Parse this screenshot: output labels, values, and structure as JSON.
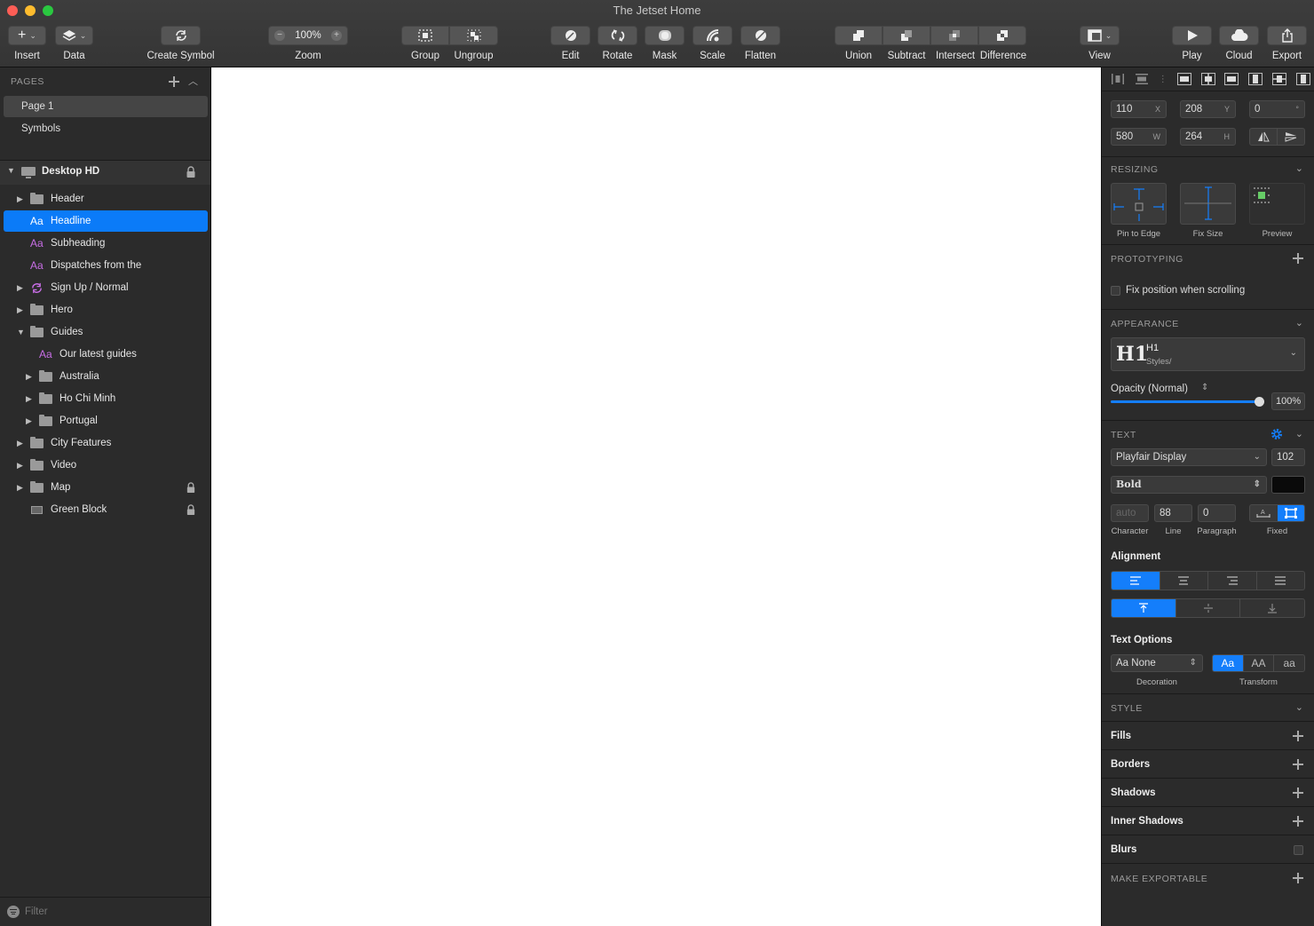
{
  "window": {
    "title": "The Jetset Home"
  },
  "toolbar": {
    "insert": "Insert",
    "data": "Data",
    "create_symbol": "Create Symbol",
    "zoom_value": "100%",
    "zoom": "Zoom",
    "group": "Group",
    "ungroup": "Ungroup",
    "edit": "Edit",
    "rotate": "Rotate",
    "mask": "Mask",
    "scale": "Scale",
    "flatten": "Flatten",
    "union": "Union",
    "subtract": "Subtract",
    "intersect": "Intersect",
    "difference": "Difference",
    "view": "View",
    "play": "Play",
    "cloud": "Cloud",
    "export": "Export"
  },
  "pages": {
    "header": "PAGES",
    "items": [
      "Page 1",
      "Symbols"
    ]
  },
  "artboard": {
    "name": "Desktop HD"
  },
  "layers": [
    {
      "label": "Header"
    },
    {
      "label": "Headline"
    },
    {
      "label": "Subheading"
    },
    {
      "label": "Dispatches from the"
    },
    {
      "label": "Sign Up / Normal"
    },
    {
      "label": "Hero"
    },
    {
      "label": "Guides"
    },
    {
      "label": "Our latest guides"
    },
    {
      "label": "Australia"
    },
    {
      "label": "Ho Chi Minh"
    },
    {
      "label": "Portugal"
    },
    {
      "label": "City Features"
    },
    {
      "label": "Video"
    },
    {
      "label": "Map"
    },
    {
      "label": "Green Block"
    }
  ],
  "filter": {
    "placeholder": "Filter"
  },
  "inspector": {
    "x": "110",
    "x_sfx": "X",
    "y": "208",
    "y_sfx": "Y",
    "rot": "0",
    "rot_sfx": "°",
    "w": "580",
    "w_sfx": "W",
    "h": "264",
    "h_sfx": "H",
    "resizing": "RESIZING",
    "pin_to_edge": "Pin to Edge",
    "fix_size": "Fix Size",
    "preview": "Preview",
    "prototyping": "PROTOTYPING",
    "fix_position": "Fix position when scrolling",
    "appearance": "APPEARANCE",
    "style_name": "H1",
    "style_path": "Styles/",
    "style_glyph": "H1",
    "opacity_label": "Opacity (Normal)",
    "opacity_value": "100%",
    "opacity": 1.0,
    "text": "TEXT",
    "font": "Playfair Display",
    "font_size": "102",
    "weight": "Bold",
    "text_color": "#0a0a0a",
    "char": "auto",
    "line": "88",
    "para": "0",
    "cap_char": "Character",
    "cap_line": "Line",
    "cap_para": "Paragraph",
    "cap_fixed": "Fixed",
    "alignment": "Alignment",
    "text_options": "Text Options",
    "decoration": "Aa None",
    "cap_decoration": "Decoration",
    "cap_transform": "Transform",
    "transform_opts": [
      "Aa",
      "AA",
      "aa"
    ],
    "style": "STYLE",
    "fills": "Fills",
    "borders": "Borders",
    "shadows": "Shadows",
    "inner_shadows": "Inner Shadows",
    "blurs": "Blurs",
    "make_exportable": "MAKE EXPORTABLE"
  },
  "colors": {
    "accent": "#147efb",
    "selection": "#0b7bf8",
    "text_style_icon": "#c86ee6"
  }
}
